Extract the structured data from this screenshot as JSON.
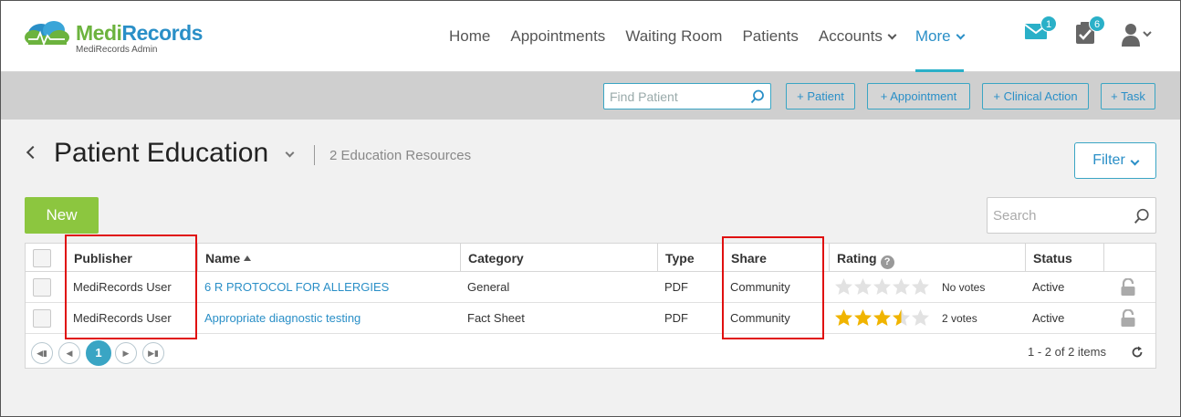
{
  "logo": {
    "name_part1": "Medi",
    "name_part2": "Records",
    "subtitle": "MediRecords Admin"
  },
  "nav": {
    "items": [
      {
        "label": "Home",
        "dropdown": false,
        "active": false
      },
      {
        "label": "Appointments",
        "dropdown": false,
        "active": false
      },
      {
        "label": "Waiting Room",
        "dropdown": false,
        "active": false
      },
      {
        "label": "Patients",
        "dropdown": false,
        "active": false
      },
      {
        "label": "Accounts",
        "dropdown": true,
        "active": false
      },
      {
        "label": "More",
        "dropdown": true,
        "active": true
      }
    ],
    "messages_badge": "1",
    "tasks_badge": "6"
  },
  "actionbar": {
    "find_placeholder": "Find Patient",
    "buttons": [
      "+ Patient",
      "+ Appointment",
      "+ Clinical Action",
      "+ Task"
    ]
  },
  "page": {
    "title": "Patient Education",
    "resource_count": "2 Education Resources",
    "filter_label": "Filter",
    "new_label": "New",
    "search_placeholder": "Search"
  },
  "grid": {
    "columns": [
      "Publisher",
      "Name",
      "Category",
      "Type",
      "Share",
      "Rating",
      "Status"
    ],
    "rows": [
      {
        "publisher": "MediRecords User",
        "name": "6 R PROTOCOL FOR ALLERGIES",
        "category": "General",
        "type": "PDF",
        "share": "Community",
        "rating": 0,
        "votes": "No votes",
        "status": "Active"
      },
      {
        "publisher": "MediRecords User",
        "name": "Appropriate diagnostic testing",
        "category": "Fact Sheet",
        "type": "PDF",
        "share": "Community",
        "rating": 3.5,
        "votes": "2 votes",
        "status": "Active"
      }
    ],
    "pager": {
      "current_page": "1",
      "items_text": "1 - 2 of 2 items"
    }
  },
  "colors": {
    "brand_green": "#6cb33e",
    "brand_blue": "#2a8fc7",
    "accent_teal": "#2ab0c8",
    "new_button": "#8cc63f",
    "star_filled": "#f0b400",
    "highlight": "#e01010"
  }
}
